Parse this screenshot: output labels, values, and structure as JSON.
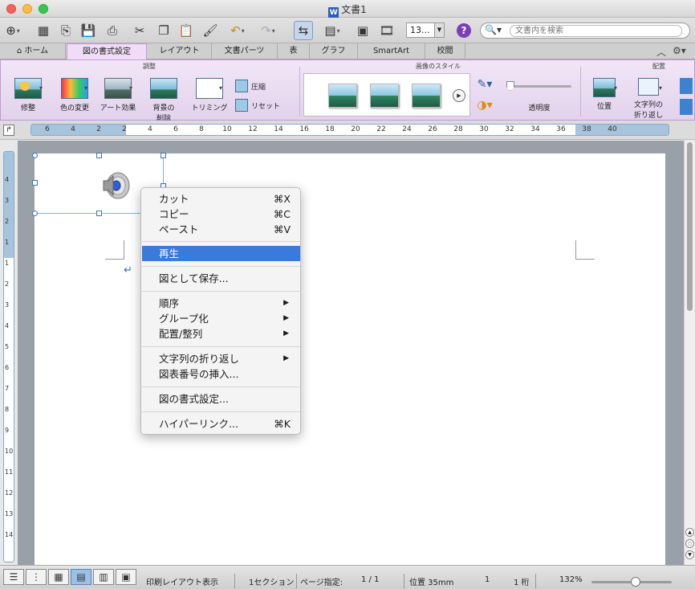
{
  "window": {
    "title": "文書1",
    "doc_icon": "W"
  },
  "toolbar": {
    "zoom_value": "13...",
    "help_label": "?",
    "search_placeholder": "文書内を検索"
  },
  "tabs": [
    {
      "label": "ホーム",
      "icon": "home-icon"
    },
    {
      "label": "図の書式設定",
      "active": true
    },
    {
      "label": "レイアウト"
    },
    {
      "label": "文書パーツ"
    },
    {
      "label": "表"
    },
    {
      "label": "グラフ"
    },
    {
      "label": "SmartArt"
    },
    {
      "label": "校閲"
    }
  ],
  "ribbon": {
    "groups": {
      "adjust": "調整",
      "picture_styles": "画像のスタイル",
      "arrange": "配置"
    },
    "buttons": {
      "corrections": "修整",
      "recolor": "色の変更",
      "artistic": "アート効果",
      "remove_bg_1": "背景の",
      "remove_bg_2": "削除",
      "crop": "トリミング",
      "compress": "圧縮",
      "reset": "リセット",
      "transparency": "透明度",
      "position": "位置",
      "wrap_1": "文字列の",
      "wrap_2": "折り返し"
    }
  },
  "ruler": {
    "labels": [
      "6",
      "4",
      "2",
      "2",
      "4",
      "6",
      "8",
      "10",
      "12",
      "14",
      "16",
      "18",
      "20",
      "22",
      "24",
      "26",
      "28",
      "30",
      "32",
      "34",
      "36",
      "38",
      "40"
    ],
    "vertical_labels": [
      "4",
      "3",
      "2",
      "1",
      "1",
      "2",
      "3",
      "4",
      "5",
      "6",
      "7",
      "8",
      "9",
      "10",
      "11",
      "12",
      "13",
      "14"
    ]
  },
  "context_menu": {
    "items": [
      {
        "label": "カット",
        "shortcut": "⌘X"
      },
      {
        "label": "コピー",
        "shortcut": "⌘C"
      },
      {
        "label": "ペースト",
        "shortcut": "⌘V"
      },
      {
        "label": "再生",
        "highlighted": true
      },
      {
        "label": "図として保存..."
      },
      {
        "label": "順序",
        "submenu": true
      },
      {
        "label": "グループ化",
        "submenu": true
      },
      {
        "label": "配置/整列",
        "submenu": true
      },
      {
        "label": "文字列の折り返し",
        "submenu": true
      },
      {
        "label": "図表番号の挿入..."
      },
      {
        "label": "図の書式設定..."
      },
      {
        "label": "ハイパーリンク...",
        "shortcut": "⌘K"
      }
    ]
  },
  "statusbar": {
    "view": "印刷レイアウト表示",
    "section": "1セクション",
    "page_label": "ページ指定:",
    "page_value": "1 / 1",
    "position": "位置 35mm",
    "line": "1",
    "column": "1 桁",
    "zoom": "132%"
  },
  "colors": {
    "accent": "#3a7ad9",
    "ribbon_active": "#f0dcf6",
    "help": "#7b3fb5"
  }
}
